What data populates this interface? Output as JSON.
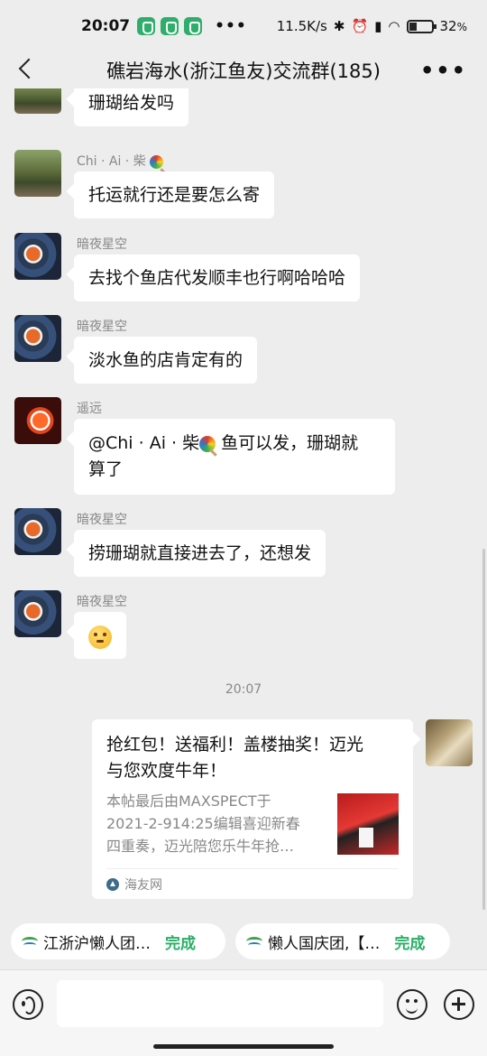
{
  "status_bar": {
    "time": "20:07",
    "dots": "•••",
    "network_speed": "11.5K/s",
    "battery": "32",
    "battery_unit": "%"
  },
  "header": {
    "title": "礁岩海水(浙江鱼友)交流群(185)",
    "more": "•••"
  },
  "messages": [
    {
      "sender": "",
      "text": "珊瑚给发吗"
    },
    {
      "sender": "Chi · Ai · 柴",
      "text": "托运就行还是要怎么寄"
    },
    {
      "sender": "暗夜星空",
      "text": "去找个鱼店代发顺丰也行啊哈哈哈"
    },
    {
      "sender": "暗夜星空",
      "text": "淡水鱼的店肯定有的"
    },
    {
      "sender": "遥远",
      "mention": "@Chi · Ai · 柴",
      "text_line1": "鱼可以发，珊瑚就",
      "text_line2": "算了"
    },
    {
      "sender": "暗夜星空",
      "text": "捞珊瑚就直接进去了，还想发"
    },
    {
      "sender": "暗夜星空",
      "emoji": "thinking-face"
    }
  ],
  "timestamp": "20:07",
  "shared_card": {
    "title_line1": "抢红包！送福利！盖楼抽奖！迈光",
    "title_line2": "与您欢度牛年！",
    "desc_line1": "本帖最后由MAXSPECT于",
    "desc_line2": "2021-2-914:25编辑喜迎新春",
    "desc_line3": "四重奏，迈光陪您乐牛年抢…",
    "source": "海友网"
  },
  "tasks": [
    {
      "label": "江浙沪懒人团…",
      "action": "完成"
    },
    {
      "label": "懒人国庆团,【…",
      "action": "完成"
    }
  ],
  "input": {
    "placeholder": ""
  }
}
